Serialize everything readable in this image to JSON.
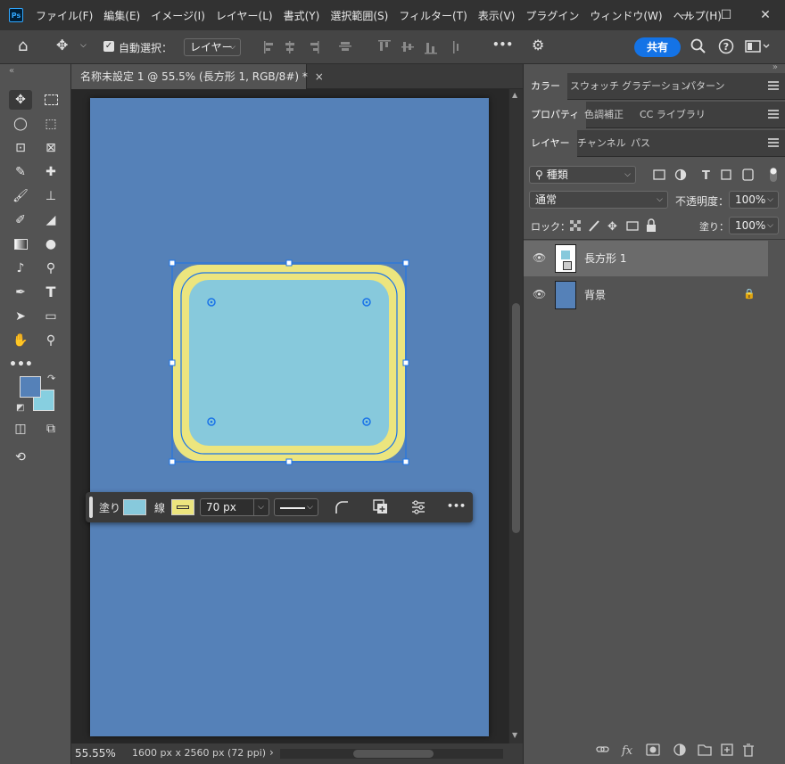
{
  "menubar": {
    "logo": "Ps",
    "items": [
      "ファイル(F)",
      "編集(E)",
      "イメージ(I)",
      "レイヤー(L)",
      "書式(Y)",
      "選択範囲(S)",
      "フィルター(T)",
      "表示(V)",
      "プラグイン",
      "ウィンドウ(W)",
      "ヘルプ(H)"
    ],
    "minimize": "—",
    "maximize": "☐",
    "close": "✕"
  },
  "options": {
    "home": "⌂",
    "move": "✥",
    "auto_select_label": "自動選択：",
    "auto_select_target": "レイヤー",
    "share": "共有",
    "more": "•••"
  },
  "document": {
    "tab_title": "名称未設定 1 @ 55.5% (長方形 1, RGB/8#) *",
    "close": "×"
  },
  "status": {
    "zoom": "55.55%",
    "info": "1600 px x 2560 px (72 ppi)",
    "arrow": "›"
  },
  "panels": {
    "row1": [
      "カラー",
      "スウォッチ",
      "グラデーション",
      "パターン"
    ],
    "row2": [
      "プロパティ",
      "色調補正",
      "CC ライブラリ"
    ],
    "row3": [
      "レイヤー",
      "チャンネル",
      "パス"
    ],
    "filter_kind": "種類",
    "blend_mode": "通常",
    "opacity_label": "不透明度：",
    "opacity_value": "100%",
    "lock_label": "ロック：",
    "fill_label": "塗り：",
    "fill_value": "100%",
    "layers": [
      {
        "name": "長方形 1",
        "selected": true
      },
      {
        "name": "背景",
        "locked": true
      }
    ]
  },
  "contextbar": {
    "fill_label": "塗り",
    "stroke_label": "線",
    "stroke_width": "70 px",
    "fill_color": "#87c9dc",
    "stroke_color": "#ece57e",
    "more": "•••"
  },
  "colors": {
    "canvas_bg": "#5581b8",
    "rect_fill": "#87c9dc",
    "rect_stroke": "#ece57e",
    "selection": "#1a73e8",
    "foreground": "#5581b8",
    "background": "#87cfe0",
    "accent": "#1473e6"
  }
}
